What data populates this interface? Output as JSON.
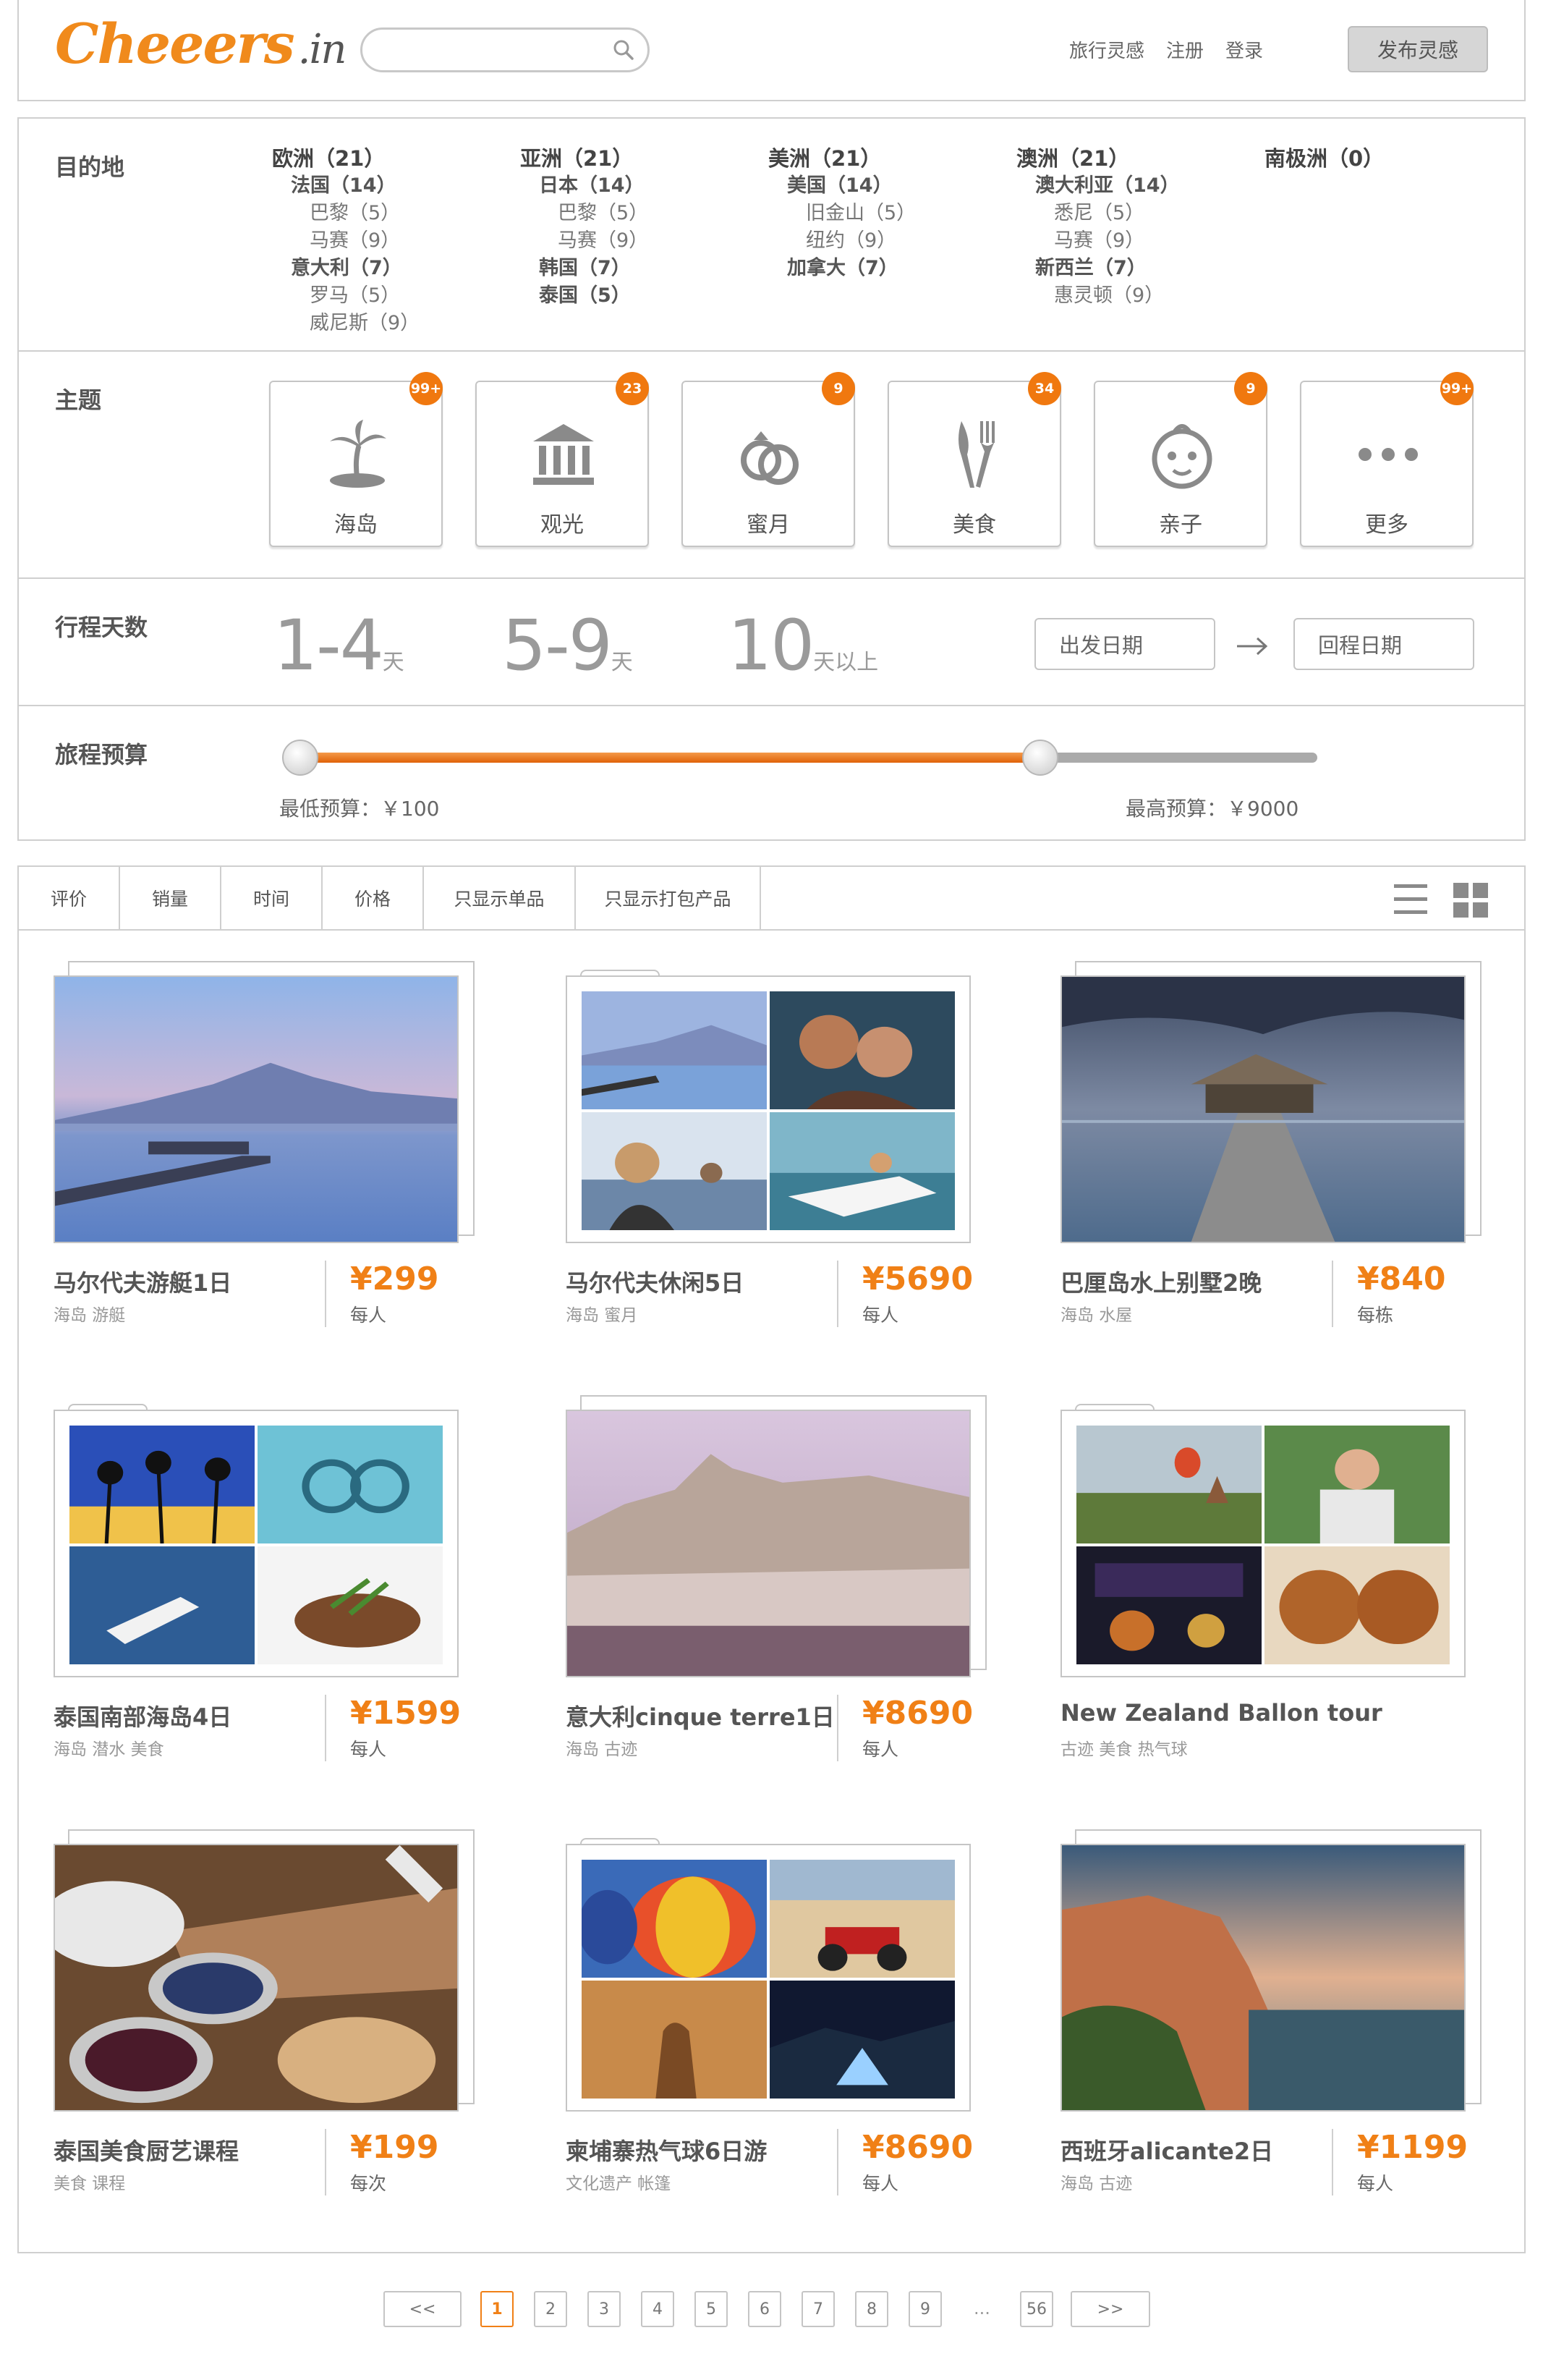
{
  "header": {
    "logo": "Cheeers",
    "logo_tld": ".in",
    "search_placeholder": "",
    "nav": [
      "旅行灵感",
      "注册",
      "登录"
    ],
    "publish_label": "发布灵感"
  },
  "destinations": {
    "label": "目的地",
    "continents": [
      {
        "name": "欧洲（21）",
        "countries": [
          {
            "name": "法国（14）",
            "cities": [
              "巴黎（5）",
              "马赛（9）"
            ]
          },
          {
            "name": "意大利（7）",
            "cities": [
              "罗马（5）",
              "威尼斯（9）"
            ]
          }
        ]
      },
      {
        "name": "亚洲（21）",
        "countries": [
          {
            "name": "日本（14）",
            "cities": [
              "巴黎（5）",
              "马赛（9）"
            ]
          },
          {
            "name": "韩国（7）",
            "cities": []
          },
          {
            "name": "泰国（5）",
            "cities": []
          }
        ]
      },
      {
        "name": "美洲（21）",
        "countries": [
          {
            "name": "美国（14）",
            "cities": [
              "旧金山（5）",
              "纽约（9）"
            ]
          },
          {
            "name": "加拿大（7）",
            "cities": []
          }
        ]
      },
      {
        "name": "澳洲（21）",
        "countries": [
          {
            "name": "澳大利亚（14）",
            "cities": [
              "悉尼（5）",
              "马赛（9）"
            ]
          },
          {
            "name": "新西兰（7）",
            "cities": [
              "惠灵顿（9）"
            ]
          }
        ]
      },
      {
        "name": "南极洲（0）",
        "countries": []
      }
    ]
  },
  "themes": {
    "label": "主题",
    "items": [
      {
        "label": "海岛",
        "badge": "99+",
        "icon": "palm-island-icon"
      },
      {
        "label": "观光",
        "badge": "23",
        "icon": "museum-icon"
      },
      {
        "label": "蜜月",
        "badge": "9",
        "icon": "rings-icon"
      },
      {
        "label": "美食",
        "badge": "34",
        "icon": "fork-knife-icon"
      },
      {
        "label": "亲子",
        "badge": "9",
        "icon": "baby-face-icon"
      },
      {
        "label": "更多",
        "badge": "99+",
        "icon": "more-dots-icon"
      }
    ]
  },
  "days": {
    "label": "行程天数",
    "options": [
      {
        "big": "1-4",
        "small": "天"
      },
      {
        "big": "5-9",
        "small": "天"
      },
      {
        "big": "10",
        "small": "天以上"
      }
    ],
    "depart_label": "出发日期",
    "return_label": "回程日期"
  },
  "budget": {
    "label": "旅程预算",
    "min_label": "最低预算：￥100",
    "max_label": "最高预算：￥9000",
    "range_fraction": [
      0.0,
      0.73
    ]
  },
  "sort": {
    "tabs": [
      "评价",
      "销量",
      "时间",
      "价格",
      "只显示单品",
      "只显示打包产品"
    ]
  },
  "products": [
    {
      "title": "马尔代夫游艇1日",
      "tags": "海岛  游艇",
      "price": "¥299",
      "unit": "每人"
    },
    {
      "title": "马尔代夫休闲5日",
      "tags": "海岛  蜜月",
      "price": "¥5690",
      "unit": "每人"
    },
    {
      "title": "巴厘岛水上别墅2晚",
      "tags": "海岛  水屋",
      "price": "¥840",
      "unit": "每栋"
    },
    {
      "title": "泰国南部海岛4日",
      "tags": "海岛  潜水  美食",
      "price": "¥1599",
      "unit": "每人"
    },
    {
      "title": "意大利cinque terre1日",
      "tags": "海岛  古迹",
      "price": "¥8690",
      "unit": "每人"
    },
    {
      "title": "New Zealand Ballon tour",
      "tags": "古迹  美食  热气球",
      "price": "",
      "unit": ""
    },
    {
      "title": "泰国美食厨艺课程",
      "tags": "美食  课程",
      "price": "¥199",
      "unit": "每次"
    },
    {
      "title": "柬埔寨热气球6日游",
      "tags": "文化遗产  帐篷",
      "price": "¥8690",
      "unit": "每人"
    },
    {
      "title": "西班牙alicante2日",
      "tags": "海岛  古迹",
      "price": "¥1199",
      "unit": "每人"
    }
  ],
  "pagination": {
    "prev": "<<",
    "pages": [
      "1",
      "2",
      "3",
      "4",
      "5",
      "6",
      "7",
      "8",
      "9"
    ],
    "ellipsis": "...",
    "last": "56",
    "next": ">>",
    "current": "1"
  },
  "colors": {
    "accent": "#f08016",
    "badge": "#f0780f",
    "border": "#cfcfcf"
  }
}
